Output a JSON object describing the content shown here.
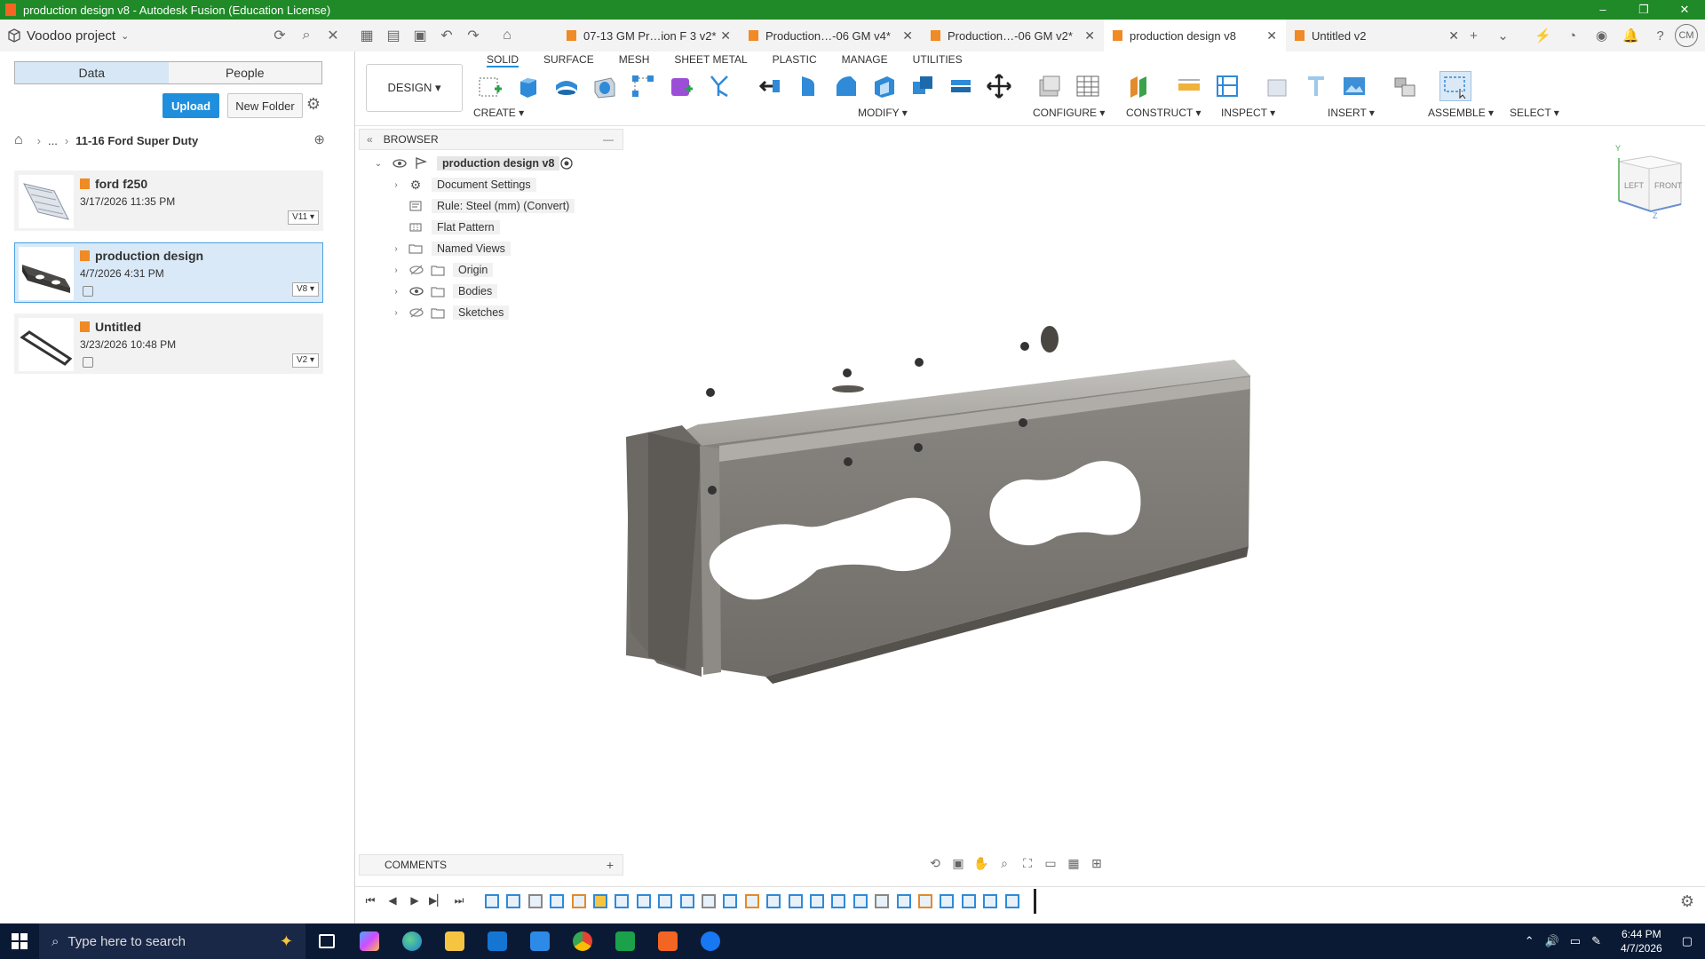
{
  "window": {
    "title": "production design v8 - Autodesk Fusion (Education License)",
    "controls": [
      "–",
      "❐",
      "✕"
    ]
  },
  "topbar": {
    "project": "Voodoo project",
    "tabs": [
      {
        "label": "07-13 GM Pr…ion F 3 v2*",
        "active": false
      },
      {
        "label": "Production…-06 GM v4*",
        "active": false
      },
      {
        "label": "Production…-06 GM v2*",
        "active": false
      },
      {
        "label": "production design v8",
        "active": true
      },
      {
        "label": "Untitled v2",
        "active": false
      }
    ],
    "user_initials": "CM"
  },
  "datapanel": {
    "tabs": [
      "Data",
      "People"
    ],
    "upload_label": "Upload",
    "newfolder_label": "New Folder",
    "breadcrumb": {
      "ellipsis": "...",
      "current": "11-16 Ford Super Duty"
    },
    "files": [
      {
        "name": "ford f250",
        "date": "3/17/2026 11:35 PM",
        "version": "V11 ▾",
        "selected": false
      },
      {
        "name": "production design",
        "date": "4/7/2026 4:31 PM",
        "version": "V8 ▾",
        "selected": true
      },
      {
        "name": "Untitled",
        "date": "3/23/2026 10:48 PM",
        "version": "V2 ▾",
        "selected": false
      }
    ]
  },
  "toolbar": {
    "workspace": "DESIGN ▾",
    "ws_tabs": [
      "SOLID",
      "SURFACE",
      "MESH",
      "SHEET METAL",
      "PLASTIC",
      "MANAGE",
      "UTILITIES"
    ],
    "groups": [
      "CREATE ▾",
      "MODIFY ▾",
      "CONFIGURE ▾",
      "CONSTRUCT ▾",
      "INSPECT ▾",
      "INSERT ▾",
      "ASSEMBLE ▾",
      "SELECT ▾"
    ]
  },
  "browser": {
    "title": "BROWSER",
    "root": "production design v8",
    "items": [
      {
        "label": "Document Settings",
        "arrow": true
      },
      {
        "label": "Rule: Steel (mm) (Convert)",
        "arrow": false
      },
      {
        "label": "Flat Pattern",
        "arrow": false
      },
      {
        "label": "Named Views",
        "arrow": true
      },
      {
        "label": "Origin",
        "arrow": true
      },
      {
        "label": "Bodies",
        "arrow": true
      },
      {
        "label": "Sketches",
        "arrow": true
      }
    ]
  },
  "viewcube": {
    "left": "LEFT",
    "front": "FRONT",
    "y": "Y",
    "z": "Z"
  },
  "comments": {
    "title": "COMMENTS"
  },
  "taskbar": {
    "search_placeholder": "Type here to search",
    "time": "6:44 PM",
    "date": "4/7/2026"
  },
  "colors": {
    "titlebar": "#1f8a27",
    "accent": "#1f8fdd",
    "selected_card": "#d9e9f7",
    "part": "#7d7a74"
  }
}
